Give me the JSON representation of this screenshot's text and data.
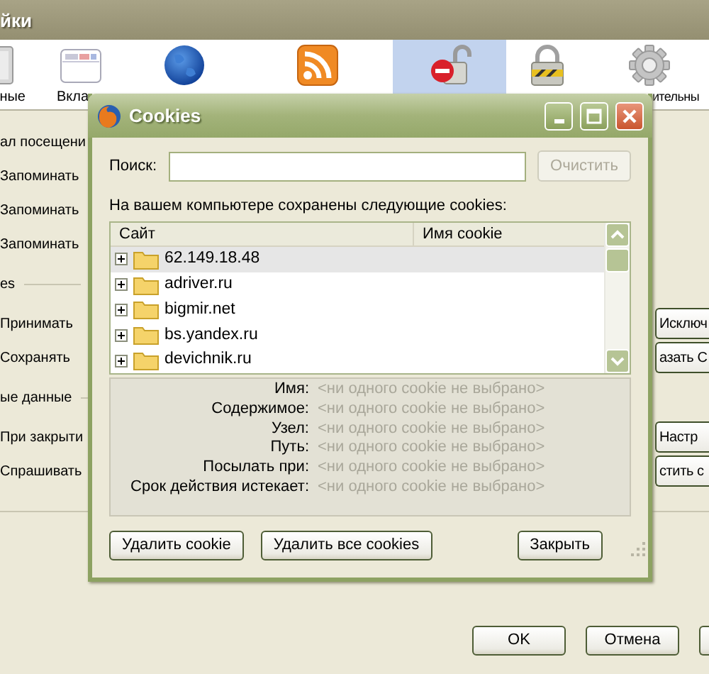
{
  "window": {
    "title": "йки"
  },
  "toolbar": [
    {
      "kind": "general",
      "label": "ные",
      "selected": false
    },
    {
      "kind": "tabs",
      "label": "Вкла",
      "selected": false
    },
    {
      "kind": "content",
      "selected": false
    },
    {
      "kind": "feeds",
      "selected": false
    },
    {
      "kind": "privacy",
      "selected": true
    },
    {
      "kind": "security",
      "selected": false
    },
    {
      "kind": "advanced",
      "label": "ительны",
      "selected": false
    }
  ],
  "options": [
    {
      "kind": "text",
      "text": "ал посещени"
    },
    {
      "kind": "text",
      "text": "Запоминать"
    },
    {
      "kind": "text",
      "text": "Запоминать"
    },
    {
      "kind": "text",
      "text": "Запоминать"
    },
    {
      "kind": "heading",
      "text": "es"
    },
    {
      "kind": "text",
      "text": "Принимать",
      "button": "Исключ"
    },
    {
      "kind": "text",
      "text": "Сохранять",
      "button": "азать С"
    },
    {
      "kind": "heading",
      "text": "ые данные"
    },
    {
      "kind": "text",
      "text": "При закрыти",
      "button": "Настр"
    },
    {
      "kind": "text",
      "text": "Спрашивать",
      "button": "стить с"
    }
  ],
  "buttons": [
    {
      "kind": "button",
      "label": "OK"
    },
    {
      "kind": "button",
      "label": "Отмена"
    },
    {
      "kind": "cut"
    }
  ],
  "cookies_dialog": {
    "title": "Cookies",
    "search_label": "Поиск:",
    "clear_button": {
      "label": "Очистить",
      "disabled": true
    },
    "intro": "На вашем компьютере сохранены следующие cookies:",
    "columns": [
      "Сайт",
      "Имя cookie"
    ],
    "sites": [
      {
        "name": "62.149.18.48",
        "selected": true
      },
      {
        "name": "adriver.ru",
        "selected": false
      },
      {
        "name": "bigmir.net",
        "selected": false
      },
      {
        "name": "bs.yandex.ru",
        "selected": false
      },
      {
        "name": "devichnik.ru",
        "selected": false
      }
    ],
    "details": [
      {
        "label": "Имя:",
        "value": "<ни одного cookie не выбрано>"
      },
      {
        "label": "Содержимое:",
        "value": "<ни одного cookie не выбрано>"
      },
      {
        "label": "Узел:",
        "value": "<ни одного cookie не выбрано>"
      },
      {
        "label": "Путь:",
        "value": "<ни одного cookie не выбрано>"
      },
      {
        "label": "Посылать при:",
        "value": "<ни одного cookie не выбрано>"
      },
      {
        "label": "Срок действия истекает:",
        "value": "<ни одного cookie не выбрано>"
      }
    ],
    "buttons": [
      "Удалить cookie",
      "Удалить все cookies",
      "Закрыть"
    ]
  }
}
